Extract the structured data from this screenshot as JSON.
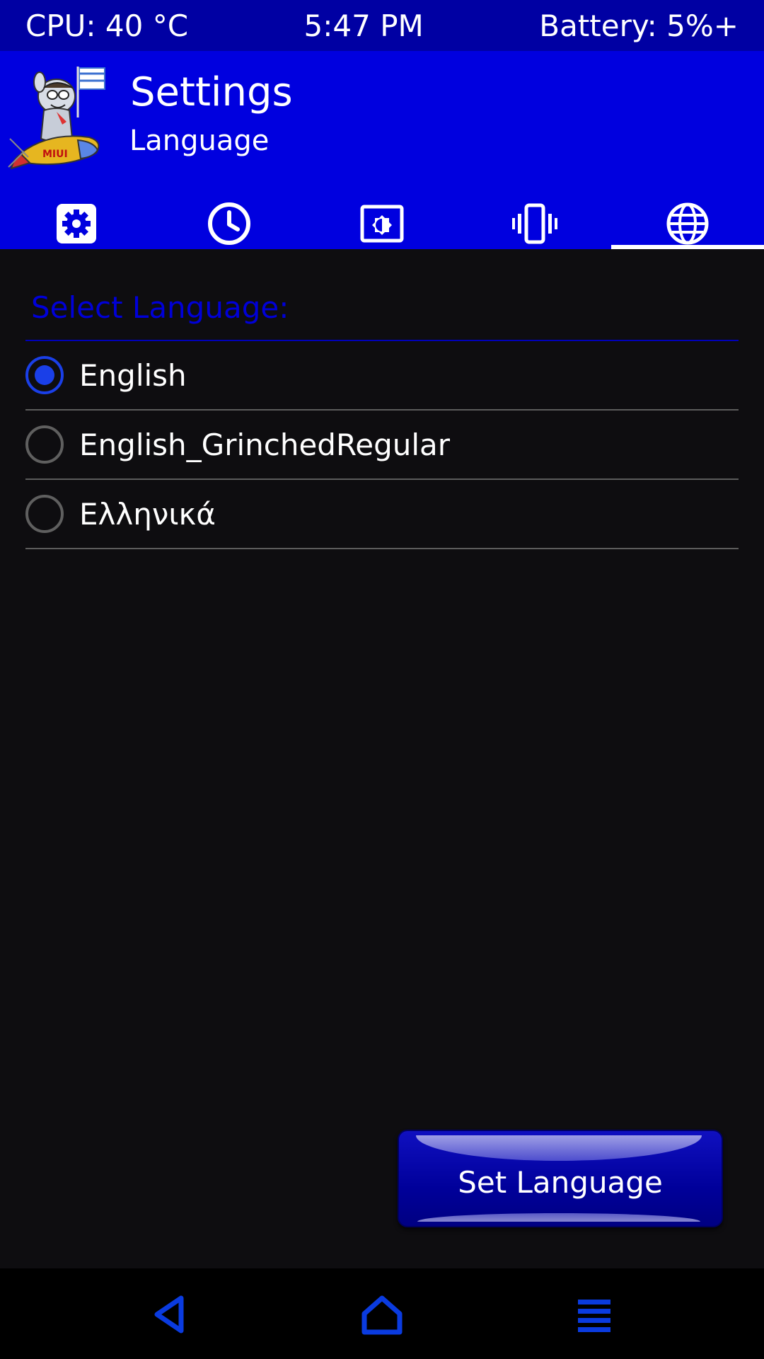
{
  "status_bar": {
    "cpu": "CPU: 40 °C",
    "time": "5:47 PM",
    "battery": "Battery: 5%+"
  },
  "header": {
    "title": "Settings",
    "subtitle": "Language",
    "logo_text": "MIUI"
  },
  "tabs": [
    {
      "icon": "gear-icon",
      "active": false
    },
    {
      "icon": "clock-icon",
      "active": false
    },
    {
      "icon": "brightness-icon",
      "active": false
    },
    {
      "icon": "vibration-icon",
      "active": false
    },
    {
      "icon": "globe-icon",
      "active": true
    }
  ],
  "content": {
    "section_label": "Select Language:",
    "languages": [
      {
        "label": "English",
        "selected": true
      },
      {
        "label": "English_GrinchedRegular",
        "selected": false
      },
      {
        "label": "Ελληνικά",
        "selected": false
      }
    ],
    "set_button_label": "Set Language"
  },
  "nav_bar": {
    "items": [
      "back-icon",
      "home-icon",
      "menu-icon"
    ]
  },
  "colors": {
    "status_bar_bg": "#0000a3",
    "header_bg": "#0000df",
    "background": "#0e0d10",
    "accent": "#1a3fe8",
    "section_label": "#0000d8",
    "nav_icons": "#0a3be0"
  }
}
